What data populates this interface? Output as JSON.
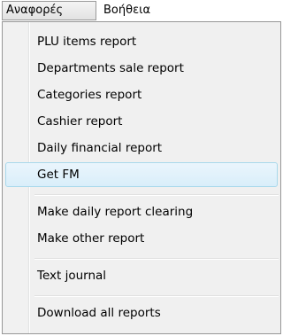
{
  "menubar": {
    "items": [
      {
        "label": "Αναφορές"
      },
      {
        "label": "Βοήθεια"
      }
    ]
  },
  "dropdown": {
    "items": [
      {
        "label": "PLU items report"
      },
      {
        "label": "Departments sale report"
      },
      {
        "label": "Categories report"
      },
      {
        "label": "Cashier report"
      },
      {
        "label": "Daily financial report"
      },
      {
        "label": "Get FM"
      },
      {
        "label": "Make daily report clearing"
      },
      {
        "label": "Make other report"
      },
      {
        "label": "Text journal"
      },
      {
        "label": "Download all reports"
      }
    ],
    "highlighted_index": 5
  }
}
